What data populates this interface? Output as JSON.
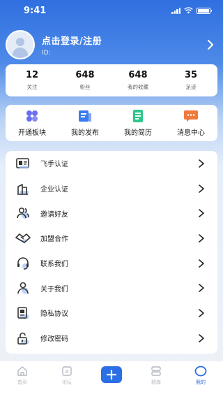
{
  "status": {
    "time": "9:41"
  },
  "profile": {
    "login_text": "点击登录/注册",
    "id_label": "ID:"
  },
  "stats": [
    {
      "value": "12",
      "label": "关注"
    },
    {
      "value": "648",
      "label": "粉丝"
    },
    {
      "value": "648",
      "label": "我的收藏"
    },
    {
      "value": "35",
      "label": "足迹"
    }
  ],
  "quick": [
    {
      "label": "开通板块",
      "icon": "grid-icon",
      "color": "#6b6ef0"
    },
    {
      "label": "我的发布",
      "icon": "post-icon",
      "color": "#3a7cf0"
    },
    {
      "label": "我的简历",
      "icon": "resume-icon",
      "color": "#2ec68a"
    },
    {
      "label": "消息中心",
      "icon": "message-icon",
      "color": "#f07a3a"
    }
  ],
  "menu": [
    {
      "label": "飞手认证",
      "icon": "id-card-icon"
    },
    {
      "label": "企业认证",
      "icon": "building-icon"
    },
    {
      "label": "邀请好友",
      "icon": "invite-friends-icon"
    },
    {
      "label": "加盟合作",
      "icon": "handshake-icon"
    },
    {
      "label": "联系我们",
      "icon": "headset-icon"
    },
    {
      "label": "关于我们",
      "icon": "about-user-icon"
    },
    {
      "label": "隐私协议",
      "icon": "privacy-doc-icon"
    },
    {
      "label": "修改密码",
      "icon": "lock-icon"
    }
  ],
  "tabs": [
    {
      "label": "首页",
      "icon": "home-icon"
    },
    {
      "label": "论坛",
      "icon": "forum-icon"
    },
    {
      "label": "",
      "icon": "plus-icon"
    },
    {
      "label": "题库",
      "icon": "question-bank-icon"
    },
    {
      "label": "我的",
      "icon": "profile-tab-icon",
      "active": true
    }
  ],
  "colors": {
    "primary": "#2a6fe4",
    "icon_accent": "#9ec0f2"
  }
}
